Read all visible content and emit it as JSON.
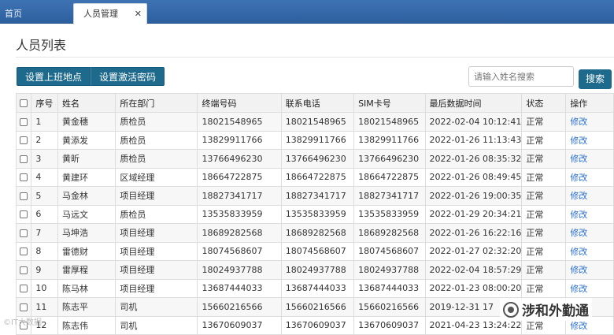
{
  "tabs": [
    {
      "label": "首页"
    },
    {
      "label": "人员管理",
      "close": "✕"
    }
  ],
  "page_title": "人员列表",
  "toolbar": {
    "set_location_label": "设置上班地点",
    "set_activation_label": "设置激活密码",
    "search_placeholder": "请输入姓名搜索",
    "search_label": "搜索"
  },
  "table": {
    "headers": [
      "序号",
      "姓名",
      "所在部门",
      "终端号码",
      "联系电话",
      "SIM卡号",
      "最后数据时间",
      "状态",
      "操作"
    ],
    "rows": [
      {
        "no": "1",
        "name": "黄金穗",
        "dept": "质检员",
        "terminal": "18021548965",
        "phone": "18021548965",
        "sim": "18021548965",
        "time": "2022-02-04 10:12:41",
        "status": "正常",
        "action": "修改"
      },
      {
        "no": "2",
        "name": "黄添发",
        "dept": "质检员",
        "terminal": "13829911766",
        "phone": "13829911766",
        "sim": "13829911766",
        "time": "2022-01-26 11:13:43",
        "status": "正常",
        "action": "修改"
      },
      {
        "no": "3",
        "name": "黄昕",
        "dept": "质检员",
        "terminal": "13766496230",
        "phone": "13766496230",
        "sim": "13766496230",
        "time": "2022-01-26 08:35:32",
        "status": "正常",
        "action": "修改"
      },
      {
        "no": "4",
        "name": "黄建环",
        "dept": "区域经理",
        "terminal": "18664722875",
        "phone": "18664722875",
        "sim": "18664722875",
        "time": "2022-01-26 08:49:45",
        "status": "正常",
        "action": "修改"
      },
      {
        "no": "5",
        "name": "马金林",
        "dept": "项目经理",
        "terminal": "18827341717",
        "phone": "18827341717",
        "sim": "18827341717",
        "time": "2022-01-26 19:00:35",
        "status": "正常",
        "action": "修改"
      },
      {
        "no": "6",
        "name": "马远文",
        "dept": "质检员",
        "terminal": "13535833959",
        "phone": "13535833959",
        "sim": "13535833959",
        "time": "2022-01-29 20:34:21",
        "status": "正常",
        "action": "修改"
      },
      {
        "no": "7",
        "name": "马坤浩",
        "dept": "项目经理",
        "terminal": "18689282568",
        "phone": "18689282568",
        "sim": "18689282568",
        "time": "2022-01-26 16:22:16",
        "status": "正常",
        "action": "修改"
      },
      {
        "no": "8",
        "name": "雷德财",
        "dept": "项目经理",
        "terminal": "18074568607",
        "phone": "18074568607",
        "sim": "18074568607",
        "time": "2022-01-27 02:32:20",
        "status": "正常",
        "action": "修改"
      },
      {
        "no": "9",
        "name": "雷厚程",
        "dept": "项目经理",
        "terminal": "18024937788",
        "phone": "18024937788",
        "sim": "18024937788",
        "time": "2022-02-04 18:57:29",
        "status": "正常",
        "action": "修改"
      },
      {
        "no": "10",
        "name": "陈马林",
        "dept": "项目经理",
        "terminal": "13687444033",
        "phone": "13687444033",
        "sim": "13687444033",
        "time": "2022-01-23 08:00:20",
        "status": "正常",
        "action": "修改"
      },
      {
        "no": "11",
        "name": "陈志平",
        "dept": "司机",
        "terminal": "15660216566",
        "phone": "15660216566",
        "sim": "15660216566",
        "time": "2019-12-31 17",
        "status": "",
        "action": ""
      },
      {
        "no": "12",
        "name": "陈志伟",
        "dept": "司机",
        "terminal": "13670609037",
        "phone": "13670609037",
        "sim": "13670609037",
        "time": "2021-04-23 13:24:22",
        "status": "正常",
        "action": "修改"
      }
    ]
  },
  "watermark": {
    "left": "©IT大数据",
    "right": "涉和外勤通"
  }
}
